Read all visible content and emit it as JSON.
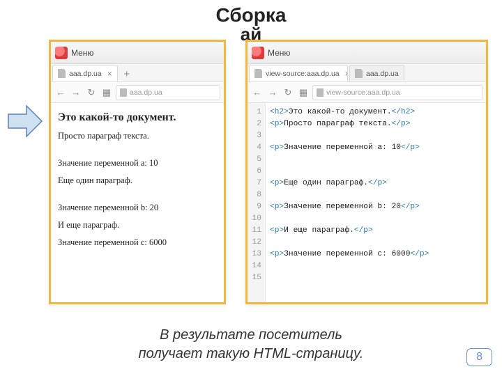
{
  "title": "Сборка",
  "title_partial": "ай",
  "arrow": {
    "fill": "#cfe0f0",
    "stroke": "#5a80c0"
  },
  "left": {
    "menu": "Меню",
    "tab": "aaa.dp.ua",
    "url": "aaa.dp.ua",
    "doc": {
      "heading": "Это какой-то документ.",
      "p1": "Просто параграф текста.",
      "p2": "Значение переменной a: 10",
      "p3": "Еще один параграф.",
      "p4": "Значение переменной b: 20",
      "p5": "И еще параграф.",
      "p6": "Значение переменной c: 6000"
    }
  },
  "right": {
    "menu": "Меню",
    "tab1": "view-source:aaa.dp.ua",
    "tab2": "aaa.dp.ua",
    "url": "view-source:aaa.dp.ua",
    "lines": [
      {
        "n": "1",
        "open": "<h2>",
        "txt": "Это какой-то документ.",
        "close": "</h2>"
      },
      {
        "n": "2",
        "open": "<p>",
        "txt": "Просто параграф текста.",
        "close": "</p>"
      },
      {
        "n": "3",
        "open": "",
        "txt": "",
        "close": ""
      },
      {
        "n": "4",
        "open": "<p>",
        "txt": "Значение переменной a: 10",
        "close": "</p>"
      },
      {
        "n": "5",
        "open": "",
        "txt": "",
        "close": ""
      },
      {
        "n": "6",
        "open": "",
        "txt": "",
        "close": ""
      },
      {
        "n": "7",
        "open": "<p>",
        "txt": "Еще один параграф.",
        "close": "</p>"
      },
      {
        "n": "8",
        "open": "",
        "txt": "",
        "close": ""
      },
      {
        "n": "9",
        "open": "<p>",
        "txt": "Значение переменной b: 20",
        "close": "</p>"
      },
      {
        "n": "10",
        "open": "",
        "txt": "",
        "close": ""
      },
      {
        "n": "11",
        "open": "<p>",
        "txt": "И еще параграф.",
        "close": "</p>"
      },
      {
        "n": "12",
        "open": "",
        "txt": "",
        "close": ""
      },
      {
        "n": "13",
        "open": "<p>",
        "txt": "Значение переменной c: 6000",
        "close": "</p>"
      },
      {
        "n": "14",
        "open": "",
        "txt": "",
        "close": ""
      },
      {
        "n": "15",
        "open": "",
        "txt": "",
        "close": ""
      }
    ]
  },
  "caption_l1": "В результате посетитель",
  "caption_l2": "получает такую HTML-страницу.",
  "page_number": "8"
}
